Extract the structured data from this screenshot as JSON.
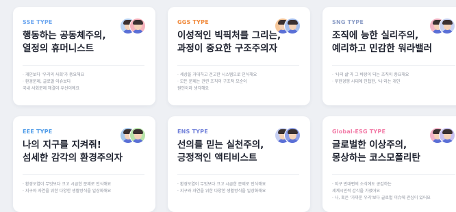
{
  "cards": [
    {
      "type": "SSE TYPE",
      "type_color": "#6fa8f0",
      "title_lines": [
        "행동하는 공동체주의,",
        "열정의 휴머니스트"
      ],
      "bullets": [
        "· 개인보다 '우리의 사회'가 중요해요",
        "· 환경문제, 글로벌 이슈보다",
        "  국내 사회문제 해결이 우선이에요"
      ],
      "avatar_colors": [
        "#bcd6f5",
        "#f6b3bd"
      ]
    },
    {
      "type": "GGS TYPE",
      "type_color": "#f08a3c",
      "title_lines": [
        "이성적인 빅픽처를 그리는,",
        "과정이 중요한 구조주의자"
      ],
      "bullets": [
        "· 세상을 거대하고 견고한 시스템으로 인식해요",
        "· 모든 문제는 관련 조직의 구조적 모순이",
        "  원인이라 생각해요"
      ],
      "avatar_colors": [
        "#f6c79a",
        "#a9c2f0"
      ]
    },
    {
      "type": "SNG TYPE",
      "type_color": "#8fa0c8",
      "title_lines": [
        "조직에 능한 실리주의,",
        "예리하고 민감한 워라밸러"
      ],
      "bullets": [
        "· '나의 삶'과 그 바탕이 되는 조직이 중요해요",
        "· 무한경쟁 시대에 민첩한, '나'라는 개인"
      ],
      "avatar_colors": [
        "#f3b6c6",
        "#c9d3f2"
      ]
    },
    {
      "type": "EEE TYPE",
      "type_color": "#4e9be8",
      "title_lines": [
        "나의 지구를 지켜줘!",
        "섬세한 감각의 환경주의자"
      ],
      "bullets": [
        "· 환경오염이 무엇보다 크고 시급한 문제로 인식해요",
        "· 지구와 자연을 위한 다양한 생활방식을 일상화해요"
      ],
      "avatar_colors": [
        "#a7c8ec",
        "#b7e3a8"
      ]
    },
    {
      "type": "ENS TYPE",
      "type_color": "#6f7fd9",
      "title_lines": [
        "선의를 믿는 실천주의,",
        "긍정적인 액티비스트"
      ],
      "bullets": [
        "· 환경오염이 무엇보다 크고 시급한 문제로 인식해요",
        "· 지구와 자연을 위한 다양한 생활방식을 일상화해요"
      ],
      "avatar_colors": [
        "#c6cff2",
        "#8fa0e8"
      ]
    },
    {
      "type": "Global-ESG TYPE",
      "type_color": "#f27aa6",
      "title_lines": [
        "글로벌한 이상주의,",
        "몽상하는 코스모폴리탄"
      ],
      "bullets": [
        "· 지구 반대편의 소식에도 공감하는",
        "  세계시민적 감각을 가졌어요",
        "· 나, 혹은 '가까운 우리'보다 글로벌 이슈에 관심이 있어요"
      ],
      "avatar_colors": [
        "#f3b4c9",
        "#c9c2f0"
      ]
    }
  ]
}
